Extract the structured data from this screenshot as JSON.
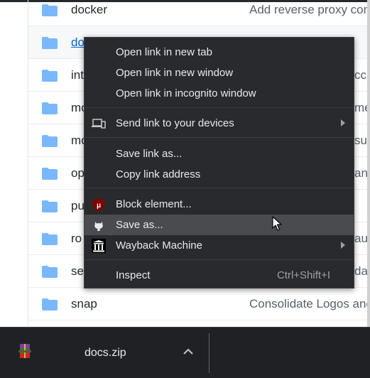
{
  "file_rows": [
    {
      "name": "docker",
      "message": "Add reverse proxy con"
    },
    {
      "name": "do",
      "message": ""
    },
    {
      "name": "int",
      "message": "ccu"
    },
    {
      "name": "mo",
      "message": "mer"
    },
    {
      "name": "mo",
      "message": "sue"
    },
    {
      "name": "op",
      "message": "ans"
    },
    {
      "name": "pu",
      "message": ""
    },
    {
      "name": "ro",
      "message": "auth"
    },
    {
      "name": "se",
      "message": "dat"
    },
    {
      "name": "snap",
      "message": "Consolidate Logos and"
    }
  ],
  "context_menu": {
    "open_new_tab": "Open link in new tab",
    "open_new_window": "Open link in new window",
    "open_incognito": "Open link in incognito window",
    "send_to_devices": "Send link to your devices",
    "save_link_as": "Save link as...",
    "copy_link_address": "Copy link address",
    "block_element": "Block element...",
    "save_as": "Save as...",
    "wayback_machine": "Wayback Machine",
    "inspect": "Inspect",
    "inspect_shortcut": "Ctrl+Shift+I"
  },
  "download_bar": {
    "file_name": "docs.zip"
  },
  "colors": {
    "folder": "#79b8ff",
    "link": "#0366d6",
    "menu_bg": "#292a2d",
    "menu_text": "#e8eaed",
    "ublock_red": "#800000",
    "download_bar_bg": "#202124"
  },
  "icons": {
    "folder": "folder-icon",
    "devices": "devices-icon",
    "ublock": "ublock-shield-icon",
    "github": "github-octocat-icon",
    "wayback": "wayback-machine-icon",
    "submenu": "chevron-right-icon",
    "archive": "winrar-archive-icon",
    "expand": "chevron-up-icon",
    "cursor": "mouse-pointer-icon"
  }
}
